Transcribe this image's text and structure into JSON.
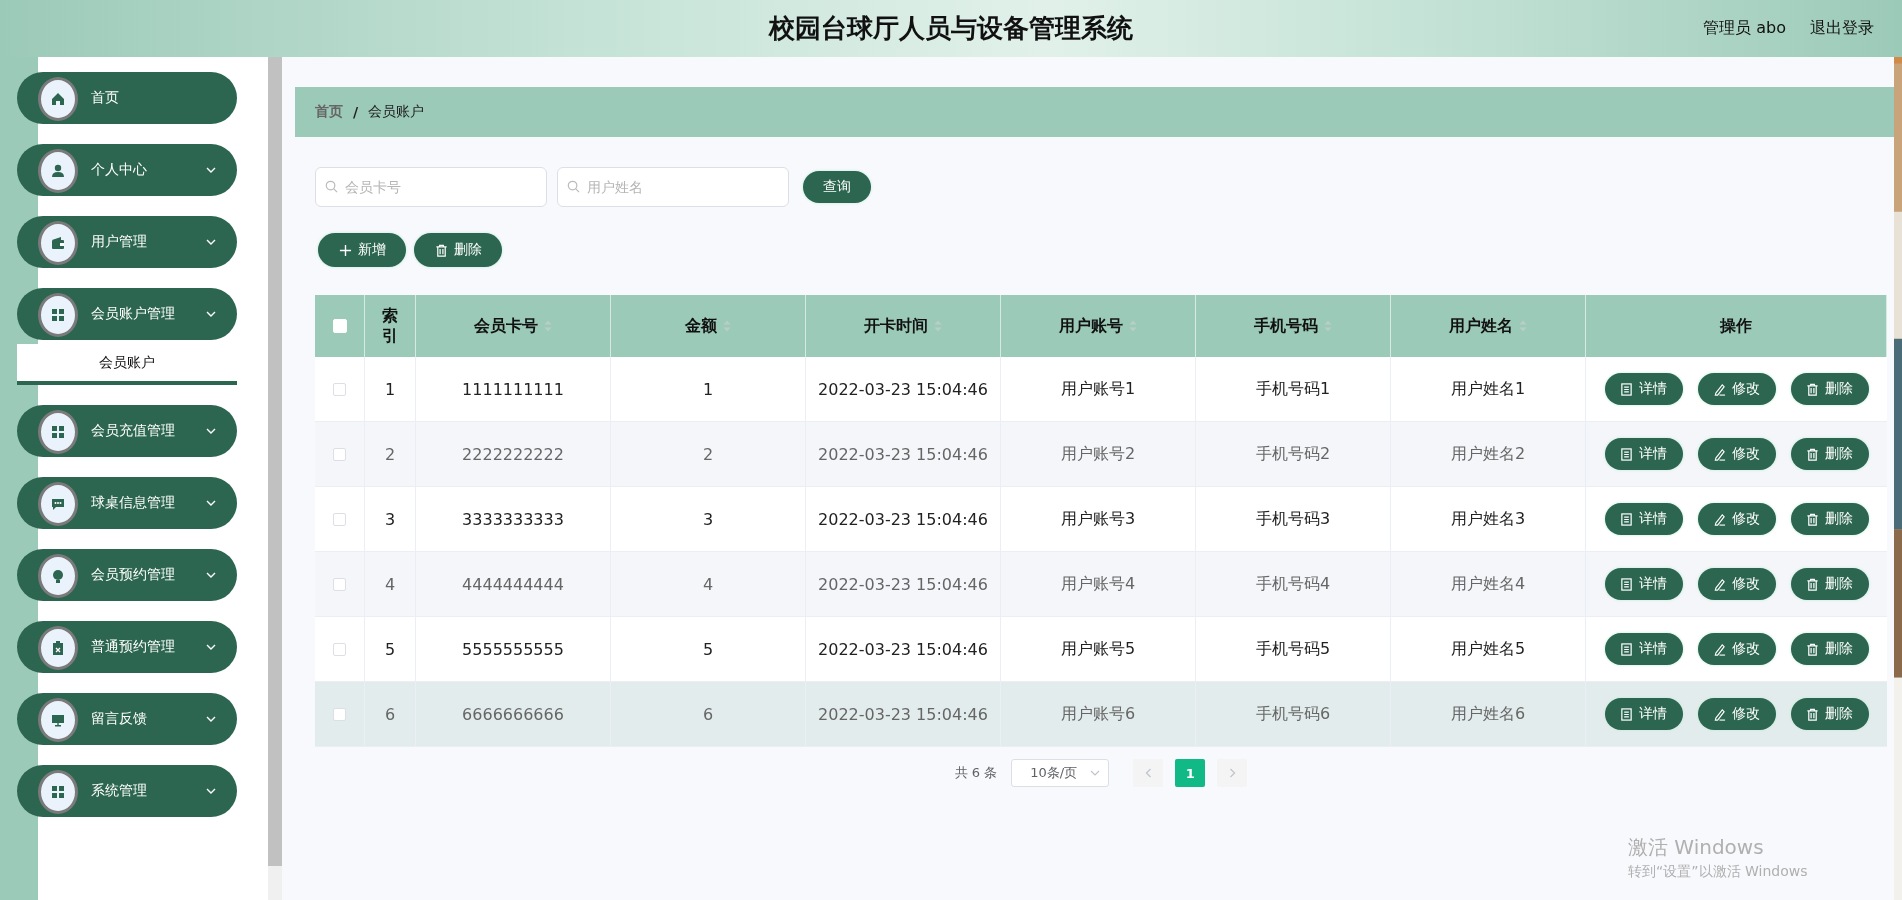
{
  "header": {
    "title": "校园台球厅人员与设备管理系统",
    "user": "管理员 abo",
    "logout": "退出登录"
  },
  "sidebar": {
    "items": [
      {
        "label": "首页",
        "kind": "link",
        "expanded": false
      },
      {
        "label": "个人中心",
        "kind": "submenu",
        "expanded": false
      },
      {
        "label": "用户管理",
        "kind": "submenu",
        "expanded": false
      },
      {
        "label": "会员账户管理",
        "kind": "submenu",
        "expanded": true,
        "children": [
          {
            "label": "会员账户",
            "selected": true
          }
        ]
      },
      {
        "label": "会员充值管理",
        "kind": "submenu",
        "expanded": false
      },
      {
        "label": "球桌信息管理",
        "kind": "submenu",
        "expanded": false
      },
      {
        "label": "会员预约管理",
        "kind": "submenu",
        "expanded": false
      },
      {
        "label": "普通预约管理",
        "kind": "submenu",
        "expanded": false
      },
      {
        "label": "留言反馈",
        "kind": "submenu",
        "expanded": false
      },
      {
        "label": "系统管理",
        "kind": "submenu",
        "expanded": false
      }
    ]
  },
  "breadcrumb": [
    "首页",
    "/",
    "会员账户"
  ],
  "search": {
    "fields": [
      {
        "placeholder": "会员卡号"
      },
      {
        "placeholder": "用户姓名"
      }
    ],
    "button": "查询"
  },
  "toolbar": [
    {
      "label": "新增",
      "kind": "add"
    },
    {
      "label": "删除",
      "kind": "delete"
    }
  ],
  "table": {
    "select_all_checked": false,
    "columns": [
      {
        "label": "索引",
        "sortable": false
      },
      {
        "label": "会员卡号",
        "sortable": true
      },
      {
        "label": "金额",
        "sortable": true
      },
      {
        "label": "开卡时间",
        "sortable": true
      },
      {
        "label": "用户账号",
        "sortable": true
      },
      {
        "label": "手机号码",
        "sortable": true
      },
      {
        "label": "用户姓名",
        "sortable": true
      },
      {
        "label": "操作",
        "sortable": false
      }
    ],
    "rows": [
      {
        "checked": false,
        "highlighted": false,
        "cells": [
          "1",
          "1111111111",
          "1",
          "2022-03-23 15:04:46",
          "用户账号1",
          "手机号码1",
          "用户姓名1"
        ],
        "actions": [
          "详情",
          "修改",
          "删除"
        ]
      },
      {
        "checked": false,
        "highlighted": false,
        "cells": [
          "2",
          "2222222222",
          "2",
          "2022-03-23 15:04:46",
          "用户账号2",
          "手机号码2",
          "用户姓名2"
        ],
        "actions": [
          "详情",
          "修改",
          "删除"
        ]
      },
      {
        "checked": false,
        "highlighted": false,
        "cells": [
          "3",
          "3333333333",
          "3",
          "2022-03-23 15:04:46",
          "用户账号3",
          "手机号码3",
          "用户姓名3"
        ],
        "actions": [
          "详情",
          "修改",
          "删除"
        ]
      },
      {
        "checked": false,
        "highlighted": false,
        "cells": [
          "4",
          "4444444444",
          "4",
          "2022-03-23 15:04:46",
          "用户账号4",
          "手机号码4",
          "用户姓名4"
        ],
        "actions": [
          "详情",
          "修改",
          "删除"
        ]
      },
      {
        "checked": false,
        "highlighted": false,
        "cells": [
          "5",
          "5555555555",
          "5",
          "2022-03-23 15:04:46",
          "用户账号5",
          "手机号码5",
          "用户姓名5"
        ],
        "actions": [
          "详情",
          "修改",
          "删除"
        ]
      },
      {
        "checked": false,
        "highlighted": true,
        "cells": [
          "6",
          "6666666666",
          "6",
          "2022-03-23 15:04:46",
          "用户账号6",
          "手机号码6",
          "用户姓名6"
        ],
        "actions": [
          "详情",
          "修改",
          "删除"
        ]
      }
    ]
  },
  "pagination": {
    "total": "共 6 条",
    "page_size": "10条/页",
    "pages": [
      {
        "label": "1",
        "selected": true
      }
    ]
  },
  "os_notice": {
    "title": "激活 Windows",
    "text": "转到“设置”以激活 Windows"
  }
}
